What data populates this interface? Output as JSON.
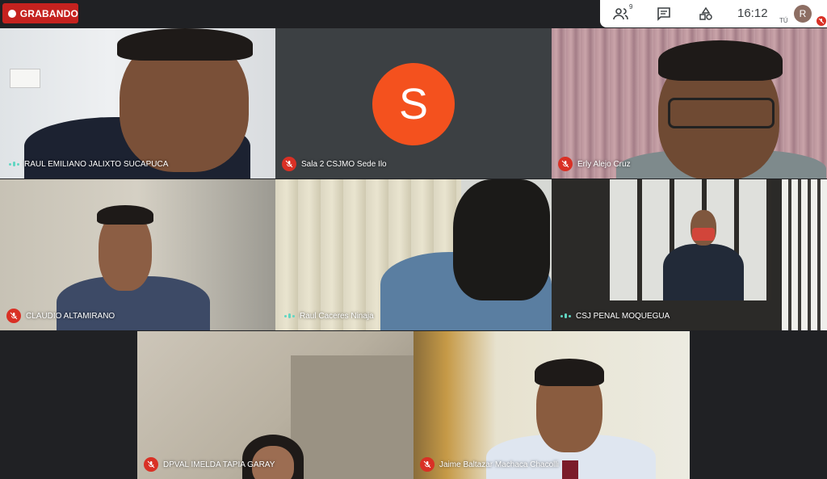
{
  "recording": {
    "label": "GRABANDO"
  },
  "topbar": {
    "participants_icon": "people-icon",
    "participants_count": "9",
    "chat_icon": "chat-icon",
    "activities_icon": "shapes-icon",
    "time": "16:12",
    "self_label": "TÚ",
    "self_avatar": "R"
  },
  "tiles": [
    {
      "name": "RAUL EMILIANO JALIXTO SUCAPUCA",
      "status": "speaking"
    },
    {
      "name": "Sala 2 CSJMO Sede Ilo",
      "status": "muted",
      "avatar": "S",
      "avatar_color": "#f4511e"
    },
    {
      "name": "Erly Alejo Cruz",
      "status": "muted"
    },
    {
      "name": "CLAUDIO ALTAMIRANO",
      "status": "muted"
    },
    {
      "name": "Raul Caceres Ninaja",
      "status": "speaking"
    },
    {
      "name": "CSJ PENAL MOQUEGUA",
      "status": "speaking"
    },
    {
      "name": "DPVAL IMELDA TAPIA GARAY",
      "status": "muted"
    },
    {
      "name": "Jaime Baltazar Machaca Chacolli",
      "status": "muted"
    }
  ],
  "colors": {
    "background": "#202124",
    "muted": "#d93025",
    "recording": "#c5221f",
    "speaking": "#61d6c2"
  }
}
